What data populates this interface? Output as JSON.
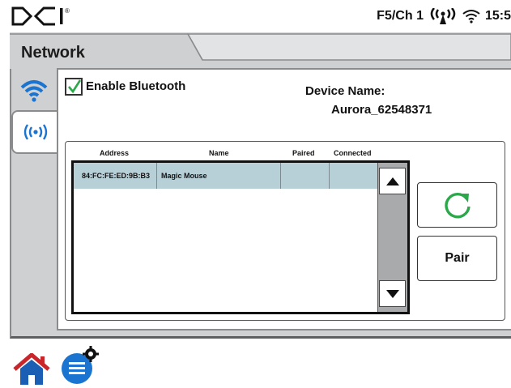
{
  "statusbar": {
    "brand": "DCI",
    "registered": "®",
    "channel": "F5/Ch 1",
    "time": "15:5",
    "icons": [
      "antenna-signal-icon",
      "wifi-icon"
    ]
  },
  "page": {
    "title": "Network",
    "tabs": [
      {
        "icon": "wifi-icon",
        "selected": false
      },
      {
        "icon": "bluetooth-broadcast-icon",
        "selected": true
      }
    ]
  },
  "bluetooth": {
    "enable_label": "Enable Bluetooth",
    "enabled": true,
    "device_name_label": "Device Name:",
    "device_name_value": "Aurora_62548371"
  },
  "device_list": {
    "columns": [
      "Address",
      "Name",
      "Paired",
      "Connected"
    ],
    "rows": [
      {
        "address": "84:FC:FE:ED:9B:B3",
        "name": "Magic Mouse",
        "paired": "",
        "connected": ""
      }
    ]
  },
  "actions": {
    "refresh_icon": "refresh-icon",
    "pair_label": "Pair"
  },
  "colors": {
    "accent_blue": "#1b75d0",
    "accent_green": "#2aa84a",
    "selected_row": "#b7cfd7",
    "frame_gray": "#cfd0d2"
  },
  "bottom_nav": {
    "icons": [
      "home-icon",
      "settings-menu-icon"
    ]
  }
}
